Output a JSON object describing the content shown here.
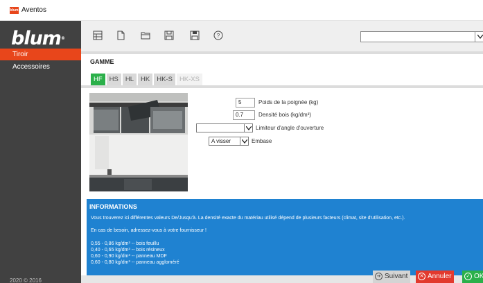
{
  "window": {
    "title": "Aventos",
    "app_icon_label": "blum"
  },
  "sidebar": {
    "logo": "blum",
    "items": [
      {
        "label": "Tiroir",
        "active": true
      },
      {
        "label": "Accessoires",
        "active": false
      }
    ],
    "copyright": "2020 © 2016"
  },
  "toolbar": {
    "buttons": [
      "layout-icon",
      "new-file-icon",
      "open-folder-icon",
      "save-icon",
      "save-as-icon",
      "help-icon"
    ],
    "select_value": ""
  },
  "gamme": {
    "title": "GAMME",
    "tabs": [
      {
        "label": "HF",
        "state": "active"
      },
      {
        "label": "HS",
        "state": "normal"
      },
      {
        "label": "HL",
        "state": "normal"
      },
      {
        "label": "HK",
        "state": "normal"
      },
      {
        "label": "HK-S",
        "state": "normal"
      },
      {
        "label": "HK-XS",
        "state": "disabled"
      }
    ]
  },
  "params": {
    "poids_value": "5",
    "poids_label": "Poids de la poignée (kg)",
    "densite_value": "0.7",
    "densite_label": "Densité bois (kg/dm³)",
    "limiteur_value": "",
    "limiteur_label": "Limiteur d'angle d'ouverture",
    "embase_value": "A visser",
    "embase_label": "Embase"
  },
  "info": {
    "title": "INFORMATIONS",
    "line1": "Vous trouverez ici différentes valeurs De/Jusqu'à. La densité exacte du matériau utilisé dépend de plusieurs facteurs (climat, site d'utilisation, etc.).",
    "line2": "En cas de besoin, adressez-vous à votre fournisseur !",
    "values": [
      "0,55 - 0,86 kg/dm³ -- bois feuillu",
      "0,40 - 0,65 kg/dm³ -- bois résineux",
      "0,60 - 0,90 kg/dm³ -- panneau MDF",
      "0,60 - 0,80 kg/dm³ -- panneau aggloméré"
    ]
  },
  "actions": {
    "next": "Suivant",
    "cancel": "Annuler",
    "ok": "OK"
  },
  "colors": {
    "brand": "#e8461b",
    "active_tab": "#2bb04a",
    "info_bg": "#1f82d1",
    "cancel": "#e23a2e",
    "sidebar": "#414141"
  }
}
